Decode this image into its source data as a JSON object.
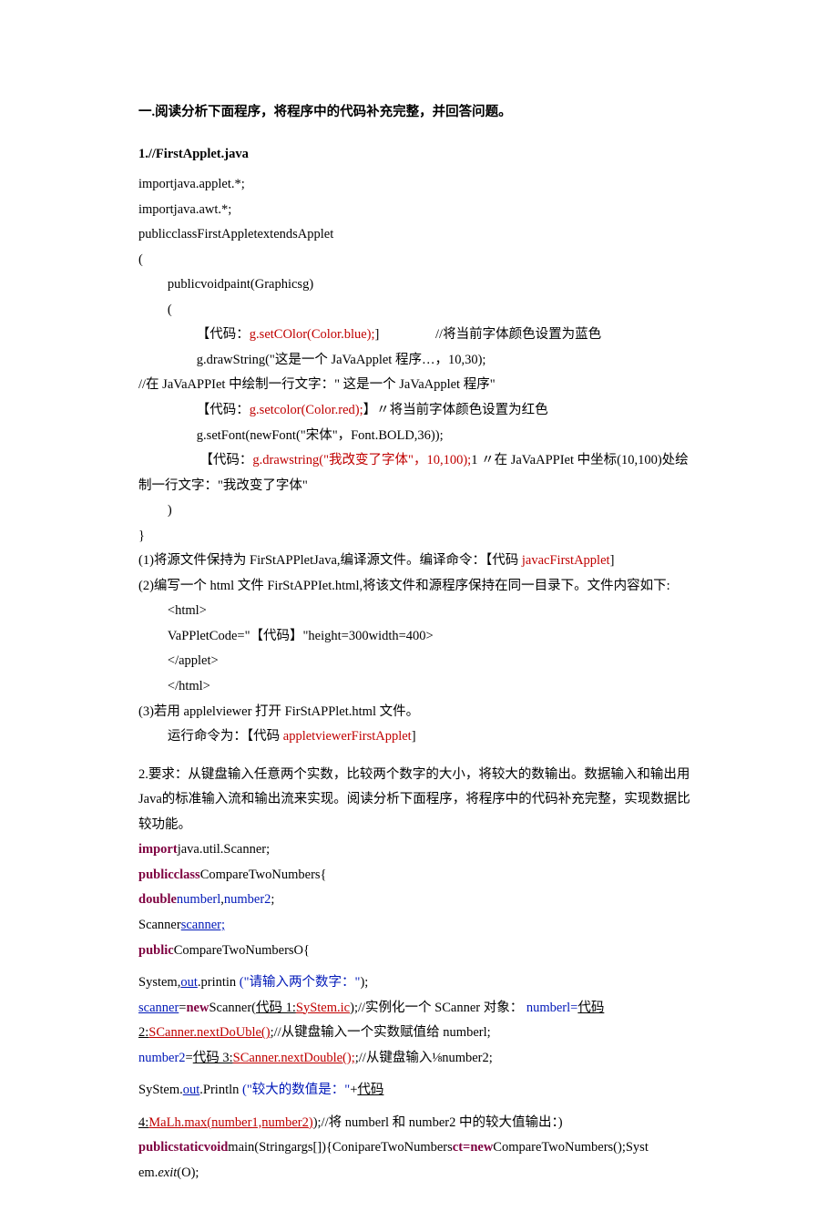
{
  "sectionTitle": "一.阅读分析下面程序，将程序中的代码补充完整，并回答问题。",
  "q1": {
    "title": "1.//FirstApplet.java",
    "l1": "importjava.applet.*;",
    "l2": "importjava.awt.*;",
    "l3": "publicclassFirstAppletextendsApplet",
    "l4": "(",
    "l5": "publicvoidpaint(Graphicsg)",
    "l6": "(",
    "l7a": "【代码：",
    "l7b": "g.setCOlor(Color.blue);",
    "l7c": "]",
    "l7d": "//将当前字体颜色设置为蓝色",
    "l8": "g.drawString(\"这是一个 JaVaApplet 程序…，10,30);",
    "l9": "//在 JaVaAPPIet 中绘制一行文字：\" 这是一个 JaVaApplet 程序\"",
    "l10a": "【代码：",
    "l10b": "g.setcolor(Color.red);",
    "l10c": "】〃将当前字体颜色设置为红色",
    "l11": "g.setFont(newFont(\"宋体\"，Font.BOLD,36));",
    "l12a": "【代码：",
    "l12b": "g.drawstring(\"我改变了字体\"，10,100);",
    "l12c": "1 〃在 JaVaAPPIet 中坐标(10,100)处绘制一行文字：\"我改变了字体\"",
    "l13": ")",
    "l14": "}",
    "p1a": "(1)将源文件保持为 FirStAPPletJava,编译源文件。编译命令：【代码 ",
    "p1b": "javacFirstApplet",
    "p1c": "]",
    "p2": "(2)编写一个 html 文件 FirStAPPIet.html,将该文件和源程序保持在同一目录下。文件内容如下:",
    "html1": "<html>",
    "html2": "VaPPletCode=\"【代码】\"height=300width=400>",
    "html3": "</applet>",
    "html4": "</html>",
    "p3": "(3)若用 applelviewer 打开 FirStAPPlet.html 文件。",
    "p3a": "运行命令为：【代码 ",
    "p3b": "appletviewerFirstApplet",
    "p3c": "]"
  },
  "q2": {
    "intro": "2.要求：从键盘输入任意两个实数，比较两个数字的大小，将较大的数输出。数据输入和输出用 Java的标准输入流和输出流来实现。阅读分析下面程序，将程序中的代码补充完整，实现数据比较功能。",
    "l1a": "import",
    "l1b": "java.util.Scanner;",
    "l2a": "publicclass",
    "l2b": "CompareTwoNumbers{",
    "l3a": "double",
    "l3b": "numberl",
    "l3c": ",",
    "l3d": "number2",
    "l3e": ";",
    "l4a": "Scanner",
    "l4b": "scanner;",
    "l5a": "public",
    "l5b": "CompareTwoNumbersO{",
    "l6a": "System,",
    "l6b": "out",
    "l6c": ".printin",
    "l6d": "(\"请输入两个数字：\"",
    "l6e": ");",
    "l7a": "scanner",
    "l7b": "=",
    "l7c": "new",
    "l7d": "Scanner(",
    "l7e": "代码 1:",
    "l7f": "SyStem.ic",
    "l7g": ");//实例化一个 SCanner 对象：",
    "l7h": "numberl=",
    "l7i": "代码",
    "l8a": "2:",
    "l8b": "SCanner.nextDoUble()",
    "l8c": ";//从键盘输入一个实数赋值给 numberl;",
    "l9a": "number2",
    "l9b": "=",
    "l9c": "代码 3:",
    "l9d": "SCanner.nextDouble();",
    "l9e": ";//从键盘输入⅛number2;",
    "l10a": "SyStem.",
    "l10b": "out",
    "l10c": ".Println",
    "l10d": "(\"较大的数值是：\"",
    "l10e": "+",
    "l10f": "代码",
    "l11a": "4:",
    "l11b": "MaLh.max(number1,number2)",
    "l11c": ");//将 numberl 和 number2 中的较大值输出：)",
    "l12a": "publicstaticvoid",
    "l12b": "main(Stringargs[]){ConipareTwoNumbers",
    "l12c": "ct=new",
    "l12d": "CompareTwoNumbers();Syst",
    "l13a": "em.",
    "l13b": "exit",
    "l13c": "(O);"
  }
}
